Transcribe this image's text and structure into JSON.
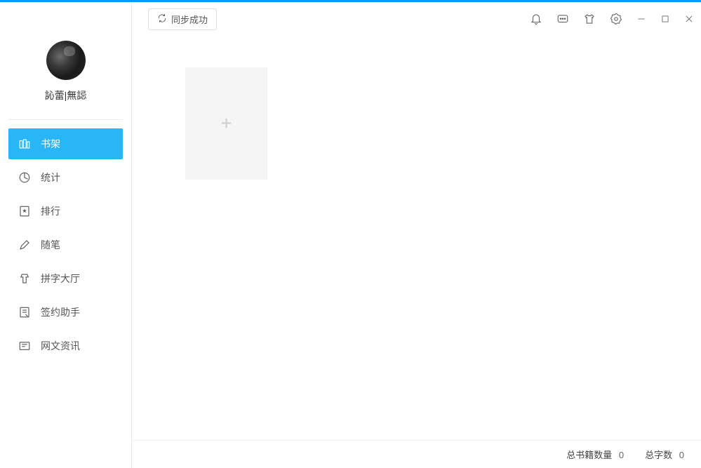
{
  "header": {
    "sync_button_label": "同步成功"
  },
  "user": {
    "name": "訫蕾|無誋"
  },
  "sidebar": {
    "items": [
      {
        "label": "书架",
        "icon": "bookshelf-icon",
        "active": true
      },
      {
        "label": "统计",
        "icon": "stats-icon",
        "active": false
      },
      {
        "label": "排行",
        "icon": "ranking-icon",
        "active": false
      },
      {
        "label": "随笔",
        "icon": "essay-icon",
        "active": false
      },
      {
        "label": "拼字大厅",
        "icon": "typing-hall-icon",
        "active": false
      },
      {
        "label": "签约助手",
        "icon": "contract-icon",
        "active": false
      },
      {
        "label": "网文资讯",
        "icon": "news-icon",
        "active": false
      }
    ]
  },
  "status": {
    "book_count_label": "总书籍数量",
    "book_count_value": "0",
    "word_count_label": "总字数",
    "word_count_value": "0"
  }
}
